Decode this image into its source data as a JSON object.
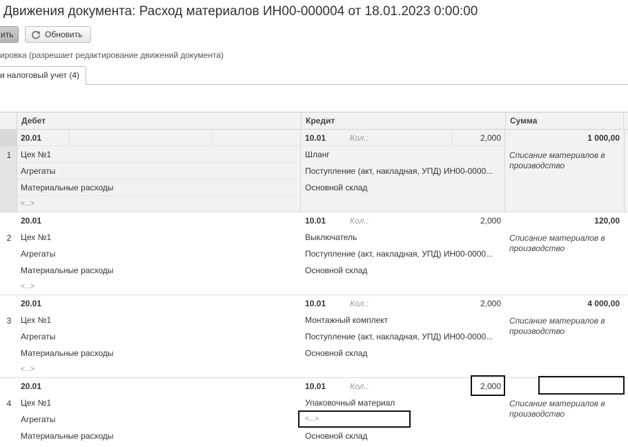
{
  "title": "Движения документа: Расход материалов ИН00-000004 от 18.01.2023 0:00:00",
  "toolbar": {
    "primary_label": "ить",
    "refresh_label": "Обновить"
  },
  "hint": "ировка (разрешает редактирование движений документа)",
  "tab_label": "и налоговый учет (4)",
  "columns": {
    "debet": "Дебет",
    "kredit": "Кредит",
    "summa": "Сумма"
  },
  "qty_label": "Кол.:",
  "ellipsis": "<...>",
  "rows": [
    {
      "n": "1",
      "debet_account": "20.01",
      "debet_sub1": "Цех №1",
      "debet_sub2": "Агрегаты",
      "debet_sub3": "Материальные расходы",
      "kredit_account": "10.01",
      "qty": "2,000",
      "kredit_sub1": "Шланг",
      "kredit_sub2": "Поступление (акт, накладная, УПД) ИН00-0000...",
      "kredit_sub3": "Основной склад",
      "amount": "1 000,00",
      "comment": "Списание материалов в производство"
    },
    {
      "n": "2",
      "debet_account": "20.01",
      "debet_sub1": "Цех №1",
      "debet_sub2": "Агрегаты",
      "debet_sub3": "Материальные расходы",
      "kredit_account": "10.01",
      "qty": "2,000",
      "kredit_sub1": "Выключатель",
      "kredit_sub2": "Поступление (акт, накладная, УПД) ИН00-0000...",
      "kredit_sub3": "Основной склад",
      "amount": "120,00",
      "comment": "Списание материалов в производство"
    },
    {
      "n": "3",
      "debet_account": "20.01",
      "debet_sub1": "Цех №1",
      "debet_sub2": "Агрегаты",
      "debet_sub3": "Материальные расходы",
      "kredit_account": "10.01",
      "qty": "2,000",
      "kredit_sub1": "Монтажный комплект",
      "kredit_sub2": "Поступление (акт, накладная, УПД) ИН00-0000...",
      "kredit_sub3": "Основной склад",
      "amount": "4 000,00",
      "comment": "Списание материалов в производство"
    },
    {
      "n": "4",
      "debet_account": "20.01",
      "debet_sub1": "Цех №1",
      "debet_sub2": "Агрегаты",
      "debet_sub3": "Материальные расходы",
      "kredit_account": "10.01",
      "qty": "2,000",
      "kredit_sub1": "Упаковочный материал",
      "kredit_sub2": "<...>",
      "kredit_sub3": "Основной склад",
      "amount": "",
      "comment": "Списание материалов в производство"
    }
  ]
}
